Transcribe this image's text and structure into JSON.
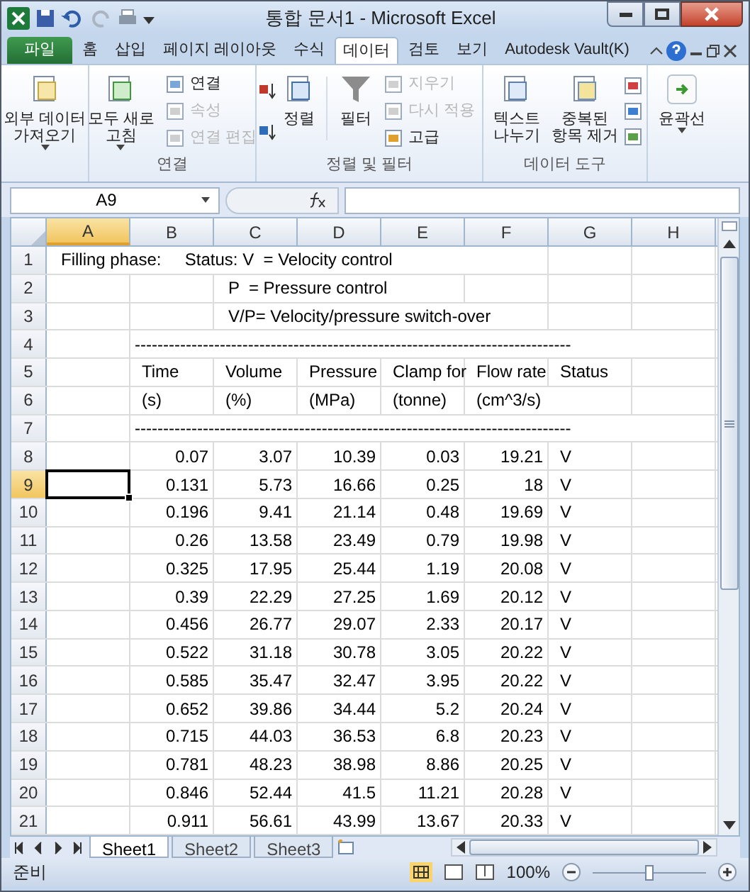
{
  "window": {
    "title": "통합 문서1 - Microsoft Excel"
  },
  "ribbon_tabs": [
    {
      "label": "파일",
      "kind": "file",
      "selected": false
    },
    {
      "label": "홈",
      "kind": "tab",
      "selected": false
    },
    {
      "label": "삽입",
      "kind": "tab",
      "selected": false
    },
    {
      "label": "페이지 레이아웃",
      "kind": "tab",
      "selected": false
    },
    {
      "label": "수식",
      "kind": "tab",
      "selected": false
    },
    {
      "label": "데이터",
      "kind": "tab",
      "selected": true
    },
    {
      "label": "검토",
      "kind": "tab",
      "selected": false
    },
    {
      "label": "보기",
      "kind": "tab",
      "selected": false
    },
    {
      "label": "Autodesk Vault(K)",
      "kind": "tab",
      "selected": false
    }
  ],
  "ribbon_groups": [
    {
      "items": [
        {
          "lines": [
            "외부 데이터",
            "가져오기"
          ],
          "disabled": false
        }
      ]
    },
    {
      "label": "연결",
      "items": [
        {
          "lines": [
            "모두 새로",
            "고침"
          ],
          "disabled": false
        },
        {
          "label": "연결",
          "disabled": false
        },
        {
          "label": "속성",
          "disabled": true
        },
        {
          "label": "연결 편집",
          "disabled": true
        }
      ]
    },
    {
      "label": "정렬 및 필터",
      "items": [
        {
          "lines": [
            "정렬"
          ],
          "disabled": false
        },
        {
          "lines": [
            "필터"
          ],
          "disabled": false
        },
        {
          "label": "지우기",
          "disabled": true
        },
        {
          "label": "다시 적용",
          "disabled": true
        },
        {
          "label": "고급",
          "disabled": false
        }
      ]
    },
    {
      "label": "데이터 도구",
      "items": [
        {
          "lines": [
            "텍스트",
            "나누기"
          ],
          "disabled": false
        },
        {
          "lines": [
            "중복된",
            "항목 제거"
          ],
          "disabled": false
        }
      ]
    },
    {
      "items": [
        {
          "lines": [
            "윤곽선"
          ],
          "disabled": false
        }
      ]
    }
  ],
  "formula_bar": {
    "name_box": "A9"
  },
  "columns": [
    {
      "label": "A",
      "selected": true
    },
    {
      "label": "B",
      "selected": false
    },
    {
      "label": "C",
      "selected": false
    },
    {
      "label": "D",
      "selected": false
    },
    {
      "label": "E",
      "selected": false
    },
    {
      "label": "F",
      "selected": false
    },
    {
      "label": "G",
      "selected": false
    },
    {
      "label": "H",
      "selected": false
    }
  ],
  "rows": [
    {
      "header": "1",
      "selected": false,
      "kind": "note",
      "cells": [
        "Filling phase:     Status: V  = Velocity control",
        null,
        null,
        null,
        null,
        null,
        null,
        null
      ]
    },
    {
      "header": "2",
      "selected": false,
      "kind": "note",
      "cells": [
        null,
        null,
        "P  = Pressure control",
        null,
        null,
        null,
        null,
        null
      ]
    },
    {
      "header": "3",
      "selected": false,
      "kind": "note",
      "cells": [
        null,
        null,
        "V/P= Velocity/pressure switch-over",
        null,
        null,
        null,
        null,
        null
      ]
    },
    {
      "header": "4",
      "selected": false,
      "kind": "rule",
      "cells": [
        null,
        "-----------------------------------------------------------------------------",
        null,
        null,
        null,
        null,
        null,
        null
      ]
    },
    {
      "header": "5",
      "selected": false,
      "kind": "header",
      "cells": [
        null,
        "Time",
        "Volume",
        "Pressure",
        "Clamp for",
        "Flow rate",
        "Status",
        null
      ]
    },
    {
      "header": "6",
      "selected": false,
      "kind": "header",
      "cells": [
        null,
        "(s)",
        "(%)",
        "(MPa)",
        "(tonne)",
        "(cm^3/s)",
        null,
        null
      ]
    },
    {
      "header": "7",
      "selected": false,
      "kind": "rule",
      "cells": [
        null,
        "-----------------------------------------------------------------------------",
        null,
        null,
        null,
        null,
        null,
        null
      ]
    },
    {
      "header": "8",
      "selected": false,
      "kind": "data",
      "cells": [
        null,
        "0.07",
        "3.07",
        "10.39",
        "0.03",
        "19.21",
        "V",
        null
      ]
    },
    {
      "header": "9",
      "selected": true,
      "kind": "data",
      "cells": [
        null,
        "0.131",
        "5.73",
        "16.66",
        "0.25",
        "18",
        "V",
        null
      ]
    },
    {
      "header": "10",
      "selected": false,
      "kind": "data",
      "cells": [
        null,
        "0.196",
        "9.41",
        "21.14",
        "0.48",
        "19.69",
        "V",
        null
      ]
    },
    {
      "header": "11",
      "selected": false,
      "kind": "data",
      "cells": [
        null,
        "0.26",
        "13.58",
        "23.49",
        "0.79",
        "19.98",
        "V",
        null
      ]
    },
    {
      "header": "12",
      "selected": false,
      "kind": "data",
      "cells": [
        null,
        "0.325",
        "17.95",
        "25.44",
        "1.19",
        "20.08",
        "V",
        null
      ]
    },
    {
      "header": "13",
      "selected": false,
      "kind": "data",
      "cells": [
        null,
        "0.39",
        "22.29",
        "27.25",
        "1.69",
        "20.12",
        "V",
        null
      ]
    },
    {
      "header": "14",
      "selected": false,
      "kind": "data",
      "cells": [
        null,
        "0.456",
        "26.77",
        "29.07",
        "2.33",
        "20.17",
        "V",
        null
      ]
    },
    {
      "header": "15",
      "selected": false,
      "kind": "data",
      "cells": [
        null,
        "0.522",
        "31.18",
        "30.78",
        "3.05",
        "20.22",
        "V",
        null
      ]
    },
    {
      "header": "16",
      "selected": false,
      "kind": "data",
      "cells": [
        null,
        "0.585",
        "35.47",
        "32.47",
        "3.95",
        "20.22",
        "V",
        null
      ]
    },
    {
      "header": "17",
      "selected": false,
      "kind": "data",
      "cells": [
        null,
        "0.652",
        "39.86",
        "34.44",
        "5.2",
        "20.24",
        "V",
        null
      ]
    },
    {
      "header": "18",
      "selected": false,
      "kind": "data",
      "cells": [
        null,
        "0.715",
        "44.03",
        "36.53",
        "6.8",
        "20.23",
        "V",
        null
      ]
    },
    {
      "header": "19",
      "selected": false,
      "kind": "data",
      "cells": [
        null,
        "0.781",
        "48.23",
        "38.98",
        "8.86",
        "20.25",
        "V",
        null
      ]
    },
    {
      "header": "20",
      "selected": false,
      "kind": "data",
      "cells": [
        null,
        "0.846",
        "52.44",
        "41.5",
        "11.21",
        "20.28",
        "V",
        null
      ]
    },
    {
      "header": "21",
      "selected": false,
      "kind": "data",
      "cells": [
        null,
        "0.911",
        "56.61",
        "43.99",
        "13.67",
        "20.33",
        "V",
        null
      ]
    }
  ],
  "sheet_tabs": [
    {
      "label": "Sheet1",
      "selected": true
    },
    {
      "label": "Sheet2",
      "selected": false
    },
    {
      "label": "Sheet3",
      "selected": false
    }
  ],
  "status_bar": {
    "status": "준비",
    "zoom": {
      "label": "100%",
      "level": 0.5
    }
  }
}
